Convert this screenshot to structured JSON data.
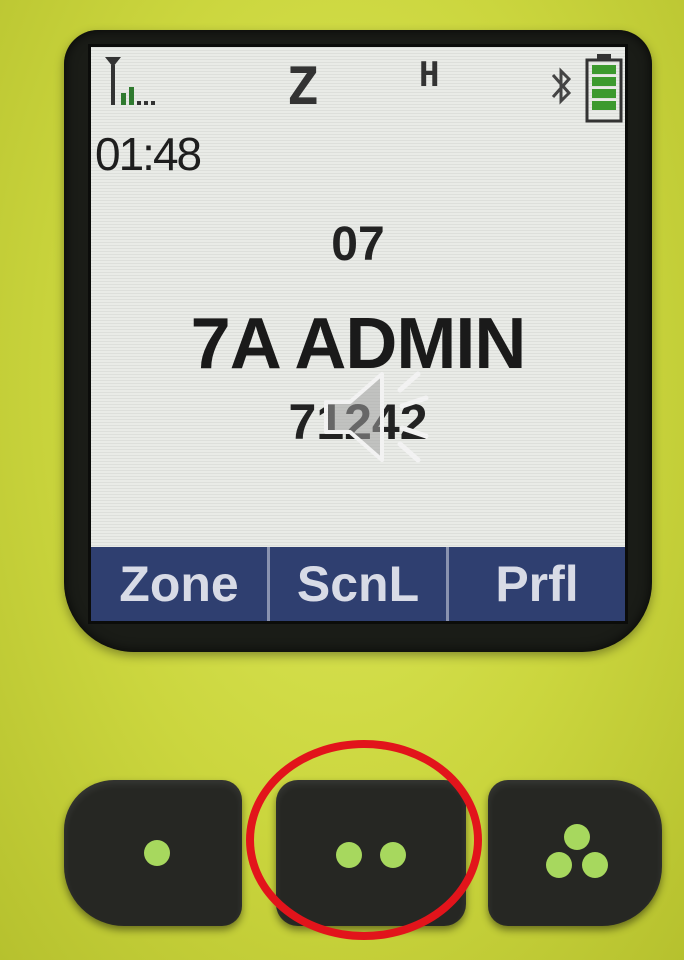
{
  "status": {
    "zone_indicator": "Z",
    "power_indicator": "H",
    "time": "01:48"
  },
  "main": {
    "channel_number": "07",
    "channel_name": "7A ADMIN",
    "talkgroup_id": "71242"
  },
  "softkeys": [
    "Zone",
    "ScnL",
    "Prfl"
  ],
  "icons": {
    "signal": "signal-strength-icon",
    "bluetooth": "bluetooth-icon",
    "battery": "battery-full-icon",
    "speaker": "speaker-audio-icon"
  },
  "colors": {
    "housing": "#c9d33a",
    "softkey_bar": "#2f3f70",
    "button_dot": "#a7d85e",
    "highlight": "#e2141b",
    "battery": "#3c9a2e"
  },
  "hardware_buttons": [
    {
      "name": "softkey-1",
      "dots": 1
    },
    {
      "name": "softkey-2",
      "dots": 2
    },
    {
      "name": "softkey-3",
      "dots": 3
    }
  ]
}
